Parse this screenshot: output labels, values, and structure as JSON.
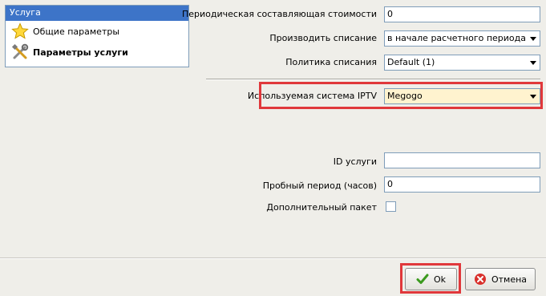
{
  "nav": {
    "header": "Услуга",
    "items": [
      {
        "label": "Общие параметры",
        "icon": "star-icon",
        "selected": false
      },
      {
        "label": "Параметры услуги",
        "icon": "tools-icon",
        "selected": true
      }
    ]
  },
  "form": {
    "periodic_cost": {
      "label": "Периодическая составляющая стоимости",
      "value": "0"
    },
    "charge_mode": {
      "label": "Производить списание",
      "value": "в начале расчетного периода"
    },
    "charge_policy": {
      "label": "Политика списания",
      "value": "Default (1)"
    },
    "iptv_system": {
      "label": "Используемая система IPTV",
      "value": "Megogo"
    },
    "service_id": {
      "label": "ID услуги",
      "value": ""
    },
    "trial_period": {
      "label": "Пробный период (часов)",
      "value": "0"
    },
    "extra_package": {
      "label": "Дополнительный пакет",
      "checked": false
    }
  },
  "buttons": {
    "ok": "Ok",
    "cancel": "Отмена"
  },
  "colors": {
    "highlight": "#e0383b",
    "nav_header": "#3d74c8",
    "selected_select": "#fff3cf"
  }
}
